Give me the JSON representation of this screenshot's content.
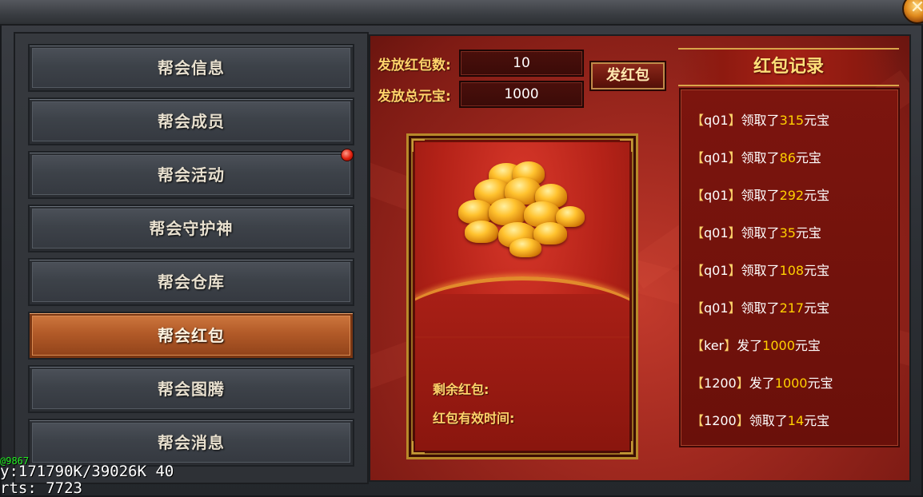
{
  "menu": {
    "items": [
      {
        "label": "帮会信息"
      },
      {
        "label": "帮会成员"
      },
      {
        "label": "帮会活动"
      },
      {
        "label": "帮会守护神"
      },
      {
        "label": "帮会仓库"
      },
      {
        "label": "帮会红包"
      },
      {
        "label": "帮会图腾"
      },
      {
        "label": "帮会消息"
      }
    ],
    "active": "帮会红包"
  },
  "form": {
    "count_label": "发放红包数:",
    "count_value": "10",
    "total_label": "发放总元宝:",
    "total_value": "1000",
    "send_button": "发红包"
  },
  "envelope": {
    "remaining_label": "剩余红包:",
    "valid_time_label": "红包有效时间:"
  },
  "records": {
    "title": "红包记录",
    "items": [
      {
        "open": "【",
        "name": "q01",
        "close": "】",
        "action": "领取了",
        "amount": "315",
        "unit": "元宝"
      },
      {
        "open": "【",
        "name": "q01",
        "close": "】",
        "action": "领取了",
        "amount": "86",
        "unit": "元宝"
      },
      {
        "open": "【",
        "name": "q01",
        "close": "】",
        "action": "领取了",
        "amount": "292",
        "unit": "元宝"
      },
      {
        "open": "【",
        "name": "q01",
        "close": "】",
        "action": "领取了",
        "amount": "35",
        "unit": "元宝"
      },
      {
        "open": "【",
        "name": "q01",
        "close": "】",
        "action": "领取了",
        "amount": "108",
        "unit": "元宝"
      },
      {
        "open": "【",
        "name": "q01",
        "close": "】",
        "action": "领取了",
        "amount": "217",
        "unit": "元宝"
      },
      {
        "open": "【",
        "name": "ker",
        "close": "】",
        "action": "发了",
        "amount": "1000",
        "unit": "元宝"
      },
      {
        "open": "【",
        "name": "1200",
        "close": "】",
        "action": "发了",
        "amount": "1000",
        "unit": "元宝"
      },
      {
        "open": "【",
        "name": "1200",
        "close": "】",
        "action": "领取了",
        "amount": "14",
        "unit": "元宝"
      }
    ]
  },
  "debug": {
    "line0": "@9867",
    "line1": "y:171790K/39026K 40",
    "line2": "rts:  7723"
  },
  "colors": {
    "accent_gold": "#ffd36b",
    "amount_yellow": "#ffd000",
    "active_menu": "#b25a28",
    "panel_red": "#a32a20"
  }
}
